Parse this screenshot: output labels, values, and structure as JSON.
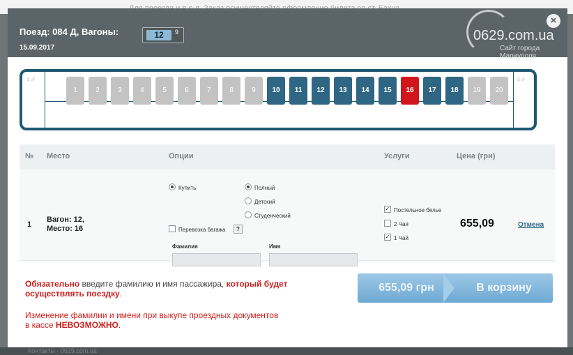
{
  "background": {
    "top_text": "Для проезда и в о.д. Заказ осуществляйте оформление билета со ст. Бахча...",
    "bottom_text": "Контакты · 0629.com.ua"
  },
  "header": {
    "train_label": "Поезд: 084 Д, Вагоны:",
    "wagon_number": "12",
    "wagon_superscript": "9",
    "date": "15.09.2017",
    "close": "×"
  },
  "watermark": {
    "site": "0629.com.ua",
    "subtitle_line1": "Сайт города",
    "subtitle_line2": "Мариуполя"
  },
  "wc_left": "♀♂",
  "wc_right": "♀♂",
  "seats": [
    {
      "num": "1",
      "state": "off"
    },
    {
      "num": "2",
      "state": "off"
    },
    {
      "num": "3",
      "state": "off"
    },
    {
      "num": "4",
      "state": "off"
    },
    {
      "num": "5",
      "state": "off"
    },
    {
      "num": "6",
      "state": "off"
    },
    {
      "num": "7",
      "state": "off"
    },
    {
      "num": "8",
      "state": "off"
    },
    {
      "num": "9",
      "state": "off"
    },
    {
      "num": "10",
      "state": "on"
    },
    {
      "num": "11",
      "state": "on"
    },
    {
      "num": "12",
      "state": "on"
    },
    {
      "num": "13",
      "state": "on"
    },
    {
      "num": "14",
      "state": "on"
    },
    {
      "num": "15",
      "state": "on"
    },
    {
      "num": "16",
      "state": "sel"
    },
    {
      "num": "17",
      "state": "on"
    },
    {
      "num": "18",
      "state": "on"
    },
    {
      "num": "19",
      "state": "off"
    },
    {
      "num": "20",
      "state": "off"
    }
  ],
  "table": {
    "headers": {
      "num": "№",
      "place": "Место",
      "options": "Опции",
      "services": "Услуги",
      "price": "Цена (грн)"
    },
    "row": {
      "num": "1",
      "place_line1": "Вагон: 12,",
      "place_line2": "Место: 16",
      "buy_label": "Купить",
      "ticket_full": "Полный",
      "ticket_child": "Детский",
      "ticket_student": "Студенческий",
      "baggage_label": "Перевозка багажа",
      "help_icon": "?",
      "surname_label": "Фамилия",
      "name_label": "Имя",
      "service_linen": "Постельное белье",
      "service_tea2": "2 Чая",
      "service_tea1": "1 Чай",
      "price": "655,09",
      "cancel": "Отмена"
    }
  },
  "warnings": {
    "w1_a": "Обязательно",
    "w1_b": " введите фамилию и имя пассажира, ",
    "w1_c": "который будет осуществлять поездку",
    "w1_d": ".",
    "w2_a": "Изменение фамилии и имени при выкупе проездных документов в кассе ",
    "w2_b": "НЕВОЗМОЖНО",
    "w2_c": "."
  },
  "cart": {
    "price": "655,09 грн",
    "label": "В корзину"
  }
}
